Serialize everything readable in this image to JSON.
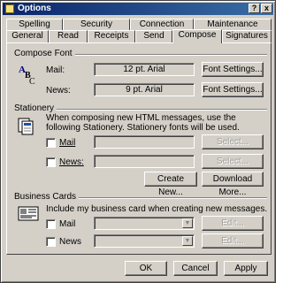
{
  "window": {
    "title": "Options",
    "help_btn": "?",
    "close_btn": "x"
  },
  "tabs_row1": [
    "Spelling",
    "Security",
    "Connection",
    "Maintenance"
  ],
  "tabs_row2": [
    "General",
    "Read",
    "Receipts",
    "Send",
    "Compose",
    "Signatures"
  ],
  "active_tab": "Compose",
  "compose_font": {
    "title": "Compose Font",
    "icon_glyph": "ABC",
    "mail_label": "Mail:",
    "mail_value": "12 pt. Arial",
    "news_label": "News:",
    "news_value": "9 pt. Arial",
    "font_settings_btn": "Font Settings..."
  },
  "stationery": {
    "title": "Stationery",
    "description": "When composing new HTML messages, use the following Stationery. Stationery fonts will be used.",
    "mail_label": "Mail",
    "news_label": "News:",
    "select_btn": "Select...",
    "create_new_btn": "Create New...",
    "download_more_btn": "Download More..."
  },
  "business_cards": {
    "title": "Business Cards",
    "description": "Include my business card when creating new messages.",
    "mail_label": "Mail",
    "news_label": "News",
    "edit_btn": "Edit..."
  },
  "footer": {
    "ok": "OK",
    "cancel": "Cancel",
    "apply": "Apply"
  }
}
